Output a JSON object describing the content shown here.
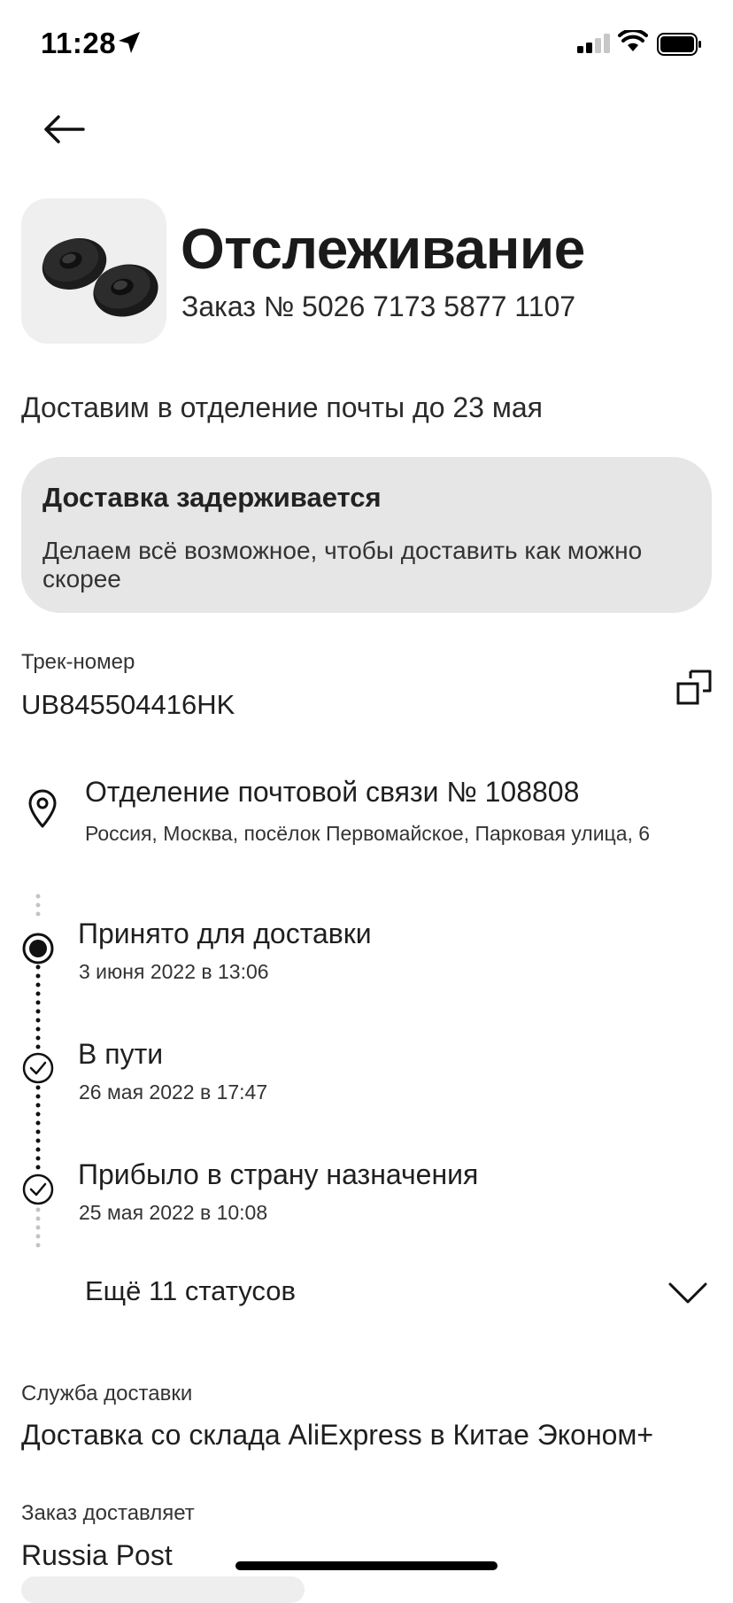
{
  "status_bar": {
    "time": "11:28"
  },
  "header": {
    "title": "Отслеживание",
    "order_number": "Заказ № 5026 7173 5877 1107"
  },
  "delivery_estimate": "Доставим в отделение почты до 23 мая",
  "delay_banner": {
    "title": "Доставка задерживается",
    "text": "Делаем всё возможное, чтобы доставить как можно скорее"
  },
  "tracking": {
    "label": "Трек-номер",
    "number": "UB845504416HK"
  },
  "pickup_point": {
    "name": "Отделение почтовой связи № 108808",
    "address": "Россия, Москва, посёлок Первомайское, Парковая улица, 6"
  },
  "timeline": [
    {
      "title": "Принято для доставки",
      "date": "3 июня 2022 в 13:06",
      "icon": "radio-filled-icon"
    },
    {
      "title": "В пути",
      "date": "26 мая 2022 в 17:47",
      "icon": "check-circle-icon"
    },
    {
      "title": "Прибыло в страну назначения",
      "date": "25 мая 2022 в 10:08",
      "icon": "check-circle-icon"
    }
  ],
  "more_statuses": "Ещё 11 статусов",
  "delivery_service": {
    "label": "Служба доставки",
    "value": "Доставка со склада AliExpress в Китае Эконом+"
  },
  "carrier": {
    "label": "Заказ доставляет",
    "value": "Russia Post"
  },
  "colors": {
    "banner_bg": "#e6e6e6",
    "thumb_bg": "#efefef",
    "text": "#1f1f1f"
  }
}
